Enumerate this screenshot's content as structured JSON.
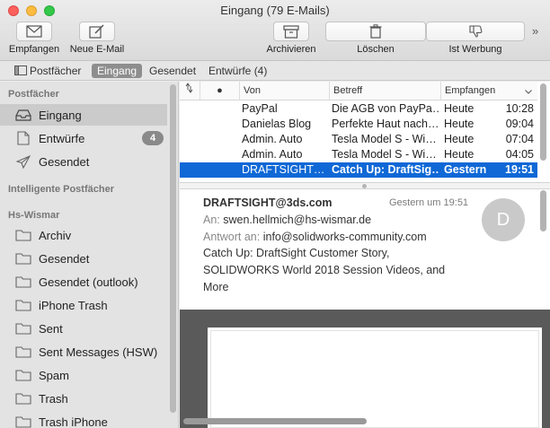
{
  "window": {
    "title": "Eingang (79 E-Mails)"
  },
  "toolbar": {
    "get_mail": "Empfangen",
    "new_mail": "Neue E-Mail",
    "archive": "Archivieren",
    "delete": "Löschen",
    "junk": "Ist Werbung",
    "more": "»"
  },
  "favorites": {
    "mailboxes": "Postfächer",
    "inbox": "Eingang",
    "sent": "Gesendet",
    "drafts": "Entwürfe (4)"
  },
  "sidebar": {
    "section_mailboxes": "Postfächer",
    "inbox": "Eingang",
    "drafts": "Entwürfe",
    "drafts_badge": "4",
    "sent": "Gesendet",
    "section_smart": "Intelligente Postfächer",
    "section_account": "Hs-Wismar",
    "folders": [
      "Archiv",
      "Gesendet",
      "Gesendet (outlook)",
      "iPhone Trash",
      "Sent",
      "Sent Messages (HSW)",
      "Spam",
      "Trash",
      "Trash iPhone"
    ]
  },
  "message_list": {
    "columns": {
      "unread": "●",
      "from": "Von",
      "subject": "Betreff",
      "received": "Empfangen"
    },
    "rows": [
      {
        "from": "PayPal",
        "subject": "Die AGB von PayPa…",
        "date": "Heute",
        "time": "10:28"
      },
      {
        "from": "Danielas Blog",
        "subject": "Perfekte Haut nach…",
        "date": "Heute",
        "time": "09:04"
      },
      {
        "from": "Admin. Auto",
        "subject": "Tesla Model S - Wi…",
        "date": "Heute",
        "time": "07:04"
      },
      {
        "from": "Admin. Auto",
        "subject": "Tesla Model S - Wi…",
        "date": "Heute",
        "time": "04:05"
      },
      {
        "from": "DRAFTSIGHT…",
        "subject": "Catch Up: DraftSig…",
        "date": "Gestern",
        "time": "19:51"
      }
    ]
  },
  "preview": {
    "from": "DRAFTSIGHT@3ds.com",
    "date": "Gestern um 19:51",
    "to_label": "An:",
    "to": "swen.hellmich@hs-wismar.de",
    "reply_label": "Antwort an:",
    "reply_to": "info@solidworks-community.com",
    "subject": "Catch Up: DraftSight Customer Story, SOLIDWORKS World 2018 Session Videos, and More",
    "avatar_initial": "D"
  },
  "colors": {
    "selection": "#0f68d6",
    "sidebar_bg": "#e3e3e3",
    "badge": "#8a8a8a"
  }
}
